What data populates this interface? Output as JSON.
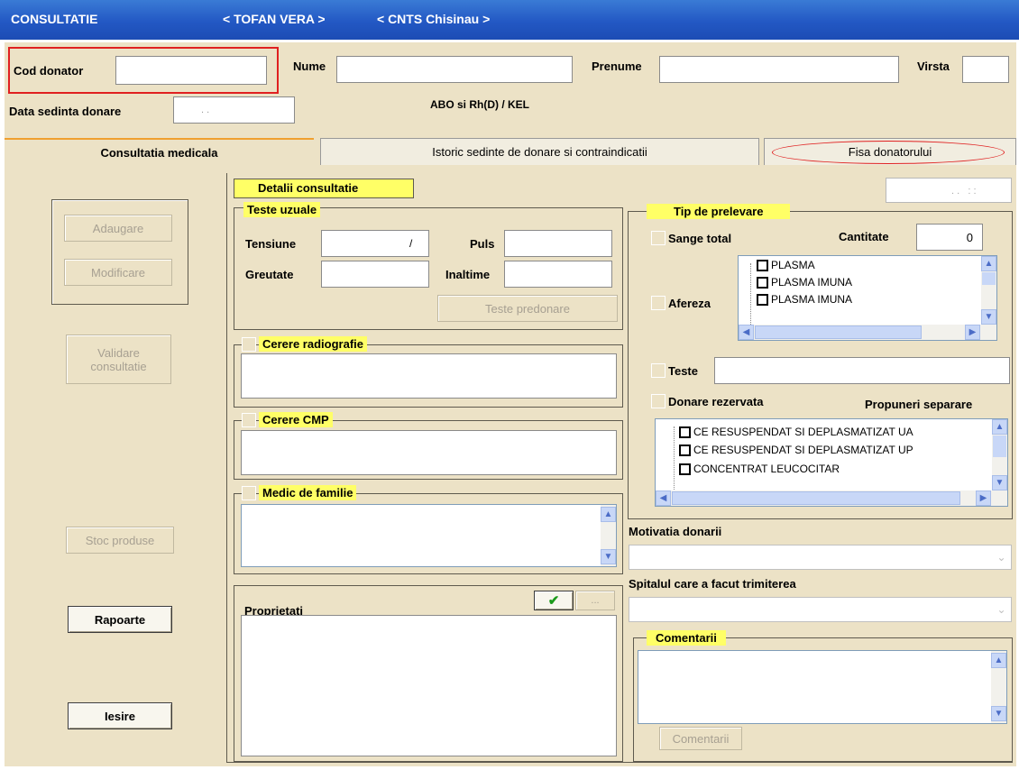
{
  "titlebar": {
    "title": "CONSULTATIE",
    "donor": "< TOFAN VERA >",
    "center": "< CNTS Chisinau >"
  },
  "header": {
    "cod_donator_label": "Cod donator",
    "nume_label": "Nume",
    "prenume_label": "Prenume",
    "virsta_label": "Virsta",
    "data_sedinta_label": "Data sedinta donare",
    "data_sedinta_value": ". .",
    "abo_label": "ABO si Rh(D) / KEL"
  },
  "tabs": [
    "Consultatia medicala",
    "Istoric sedinte de donare si contraindicatii",
    "Fisa donatorului"
  ],
  "left_buttons": {
    "adaugare": "Adaugare",
    "modificare": "Modificare",
    "validare_line1": "Validare",
    "validare_line2": "consultatie",
    "stoc": "Stoc produse",
    "rapoarte": "Rapoarte",
    "iesire": "Iesire"
  },
  "detalii": {
    "label": "Detalii consultatie",
    "datetime_value": ". .   : :"
  },
  "teste_uzuale": {
    "label": "Teste uzuale",
    "tensiune_label": "Tensiune",
    "tensiune_sep": "/",
    "puls_label": "Puls",
    "greutate_label": "Greutate",
    "inaltime_label": "Inaltime",
    "teste_predonare": "Teste predonare"
  },
  "cerere_radiografie": "Cerere radiografie",
  "cerere_cmp": "Cerere CMP",
  "medic_familie": "Medic de familie",
  "proprietati": {
    "label": "Proprietati",
    "btn_check": "✔",
    "btn_more": "..."
  },
  "tip_prelevare": {
    "label": "Tip de prelevare",
    "sange_total": "Sange total",
    "cantitate_label": "Cantitate",
    "cantitate_value": "0",
    "afereza": "Afereza",
    "afereza_items": [
      "PLASMA",
      "PLASMA IMUNA",
      "PLASMA IMUNA"
    ],
    "teste": "Teste",
    "donare_rezervata": "Donare rezervata",
    "propuneri_separare": "Propuneri separare",
    "separare_items": [
      "CE RESUSPENDAT SI DEPLASMATIZAT UA",
      "CE RESUSPENDAT SI DEPLASMATIZAT UP",
      "CONCENTRAT  LEUCOCITAR"
    ]
  },
  "motivatia_donarii": "Motivatia donarii",
  "spitalul": "Spitalul care a facut trimiterea",
  "comentarii": {
    "label": "Comentarii",
    "button": "Comentarii"
  },
  "colors": {
    "title_bar": "#2a62c9",
    "panel_bg": "#ece2c6",
    "label_highlight": "#ffff66",
    "highlight_red": "#e02020"
  }
}
